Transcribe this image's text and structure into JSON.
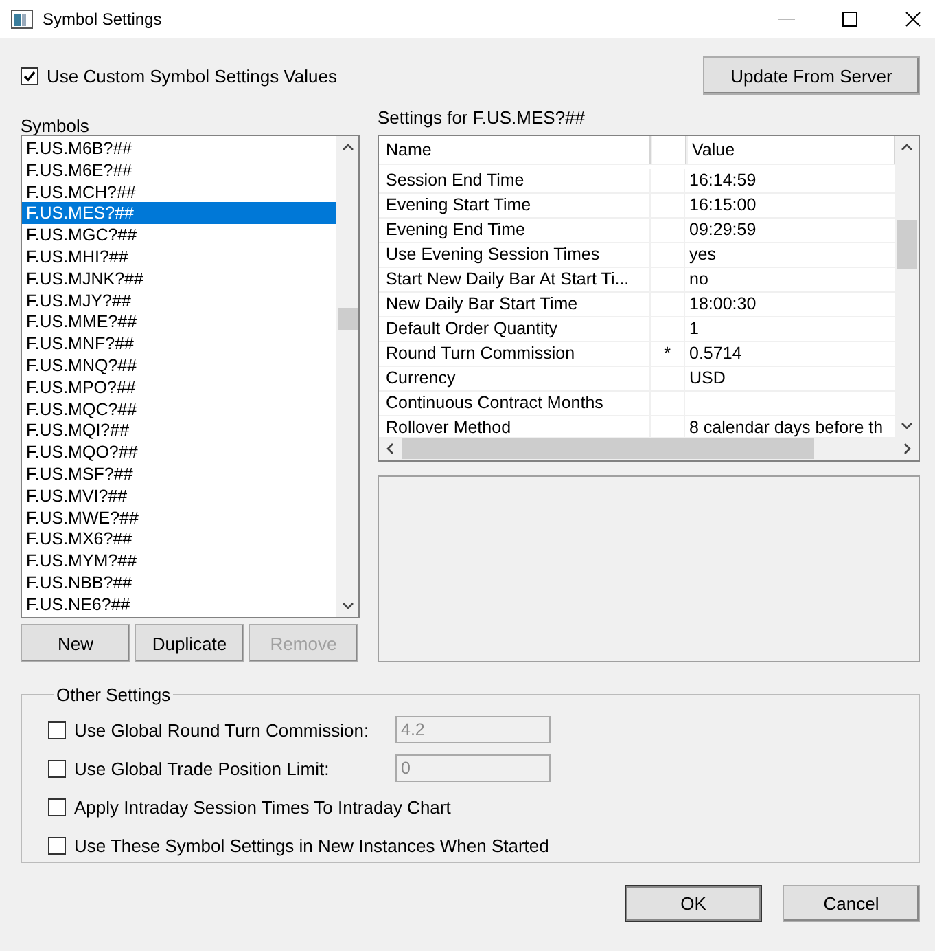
{
  "window": {
    "title": "Symbol Settings"
  },
  "use_custom": {
    "label": "Use Custom Symbol Settings Values",
    "checked": true
  },
  "update_button": {
    "label": "Update From Server"
  },
  "symbols": {
    "label": "Symbols",
    "items": [
      {
        "text": "F.US.M6B?##",
        "selected": false
      },
      {
        "text": "F.US.M6E?##",
        "selected": false
      },
      {
        "text": "F.US.MCH?##",
        "selected": false
      },
      {
        "text": "F.US.MES?##",
        "selected": true
      },
      {
        "text": "F.US.MGC?##",
        "selected": false
      },
      {
        "text": "F.US.MHI?##",
        "selected": false
      },
      {
        "text": "F.US.MJNK?##",
        "selected": false
      },
      {
        "text": "F.US.MJY?##",
        "selected": false
      },
      {
        "text": "F.US.MME?##",
        "selected": false
      },
      {
        "text": "F.US.MNF?##",
        "selected": false
      },
      {
        "text": "F.US.MNQ?##",
        "selected": false
      },
      {
        "text": "F.US.MPO?##",
        "selected": false
      },
      {
        "text": "F.US.MQC?##",
        "selected": false
      },
      {
        "text": "F.US.MQI?##",
        "selected": false
      },
      {
        "text": "F.US.MQO?##",
        "selected": false
      },
      {
        "text": "F.US.MSF?##",
        "selected": false
      },
      {
        "text": "F.US.MVI?##",
        "selected": false
      },
      {
        "text": "F.US.MWE?##",
        "selected": false
      },
      {
        "text": "F.US.MX6?##",
        "selected": false
      },
      {
        "text": "F.US.MYM?##",
        "selected": false
      },
      {
        "text": "F.US.NBB?##",
        "selected": false
      },
      {
        "text": "F.US.NE6?##",
        "selected": false
      }
    ]
  },
  "list_buttons": [
    {
      "label": "New",
      "disabled": false
    },
    {
      "label": "Duplicate",
      "disabled": false
    },
    {
      "label": "Remove",
      "disabled": true
    }
  ],
  "settings": {
    "title": "Settings for F.US.MES?##",
    "columns": [
      "Name",
      "Value"
    ],
    "rows": [
      {
        "name": "Session End Time",
        "value": "16:14:59"
      },
      {
        "name": "Evening Start Time",
        "value": "16:15:00"
      },
      {
        "name": "Evening End Time",
        "value": "09:29:59"
      },
      {
        "name": "Use Evening Session Times",
        "value": "yes"
      },
      {
        "name": "Start New Daily Bar At Start Ti...",
        "value": "no"
      },
      {
        "name": "New Daily Bar Start Time",
        "value": "18:00:30"
      },
      {
        "name": "Default Order Quantity",
        "value": "1"
      },
      {
        "name": "Round Turn Commission",
        "flag": "*",
        "value": "0.5714"
      },
      {
        "name": "Currency",
        "value": "USD"
      },
      {
        "name": "Continuous Contract Months"
      },
      {
        "name": "Rollover Method",
        "value": "8 calendar days before th"
      }
    ]
  },
  "other_settings": {
    "title": "Other Settings",
    "options": [
      {
        "label": "Use Global Round Turn Commission:",
        "checked": false,
        "field": {
          "value": "4.2",
          "disabled": true
        }
      },
      {
        "label": "Use Global Trade Position Limit:",
        "checked": false,
        "field": {
          "value": "0",
          "disabled": true
        }
      },
      {
        "label": "Apply Intraday Session Times To Intraday Chart",
        "checked": false
      },
      {
        "label": "Use These Symbol Settings in New Instances When Started",
        "checked": false
      }
    ]
  },
  "dialog_buttons": [
    {
      "label": "OK",
      "default": true
    },
    {
      "label": "Cancel",
      "default": false
    }
  ]
}
